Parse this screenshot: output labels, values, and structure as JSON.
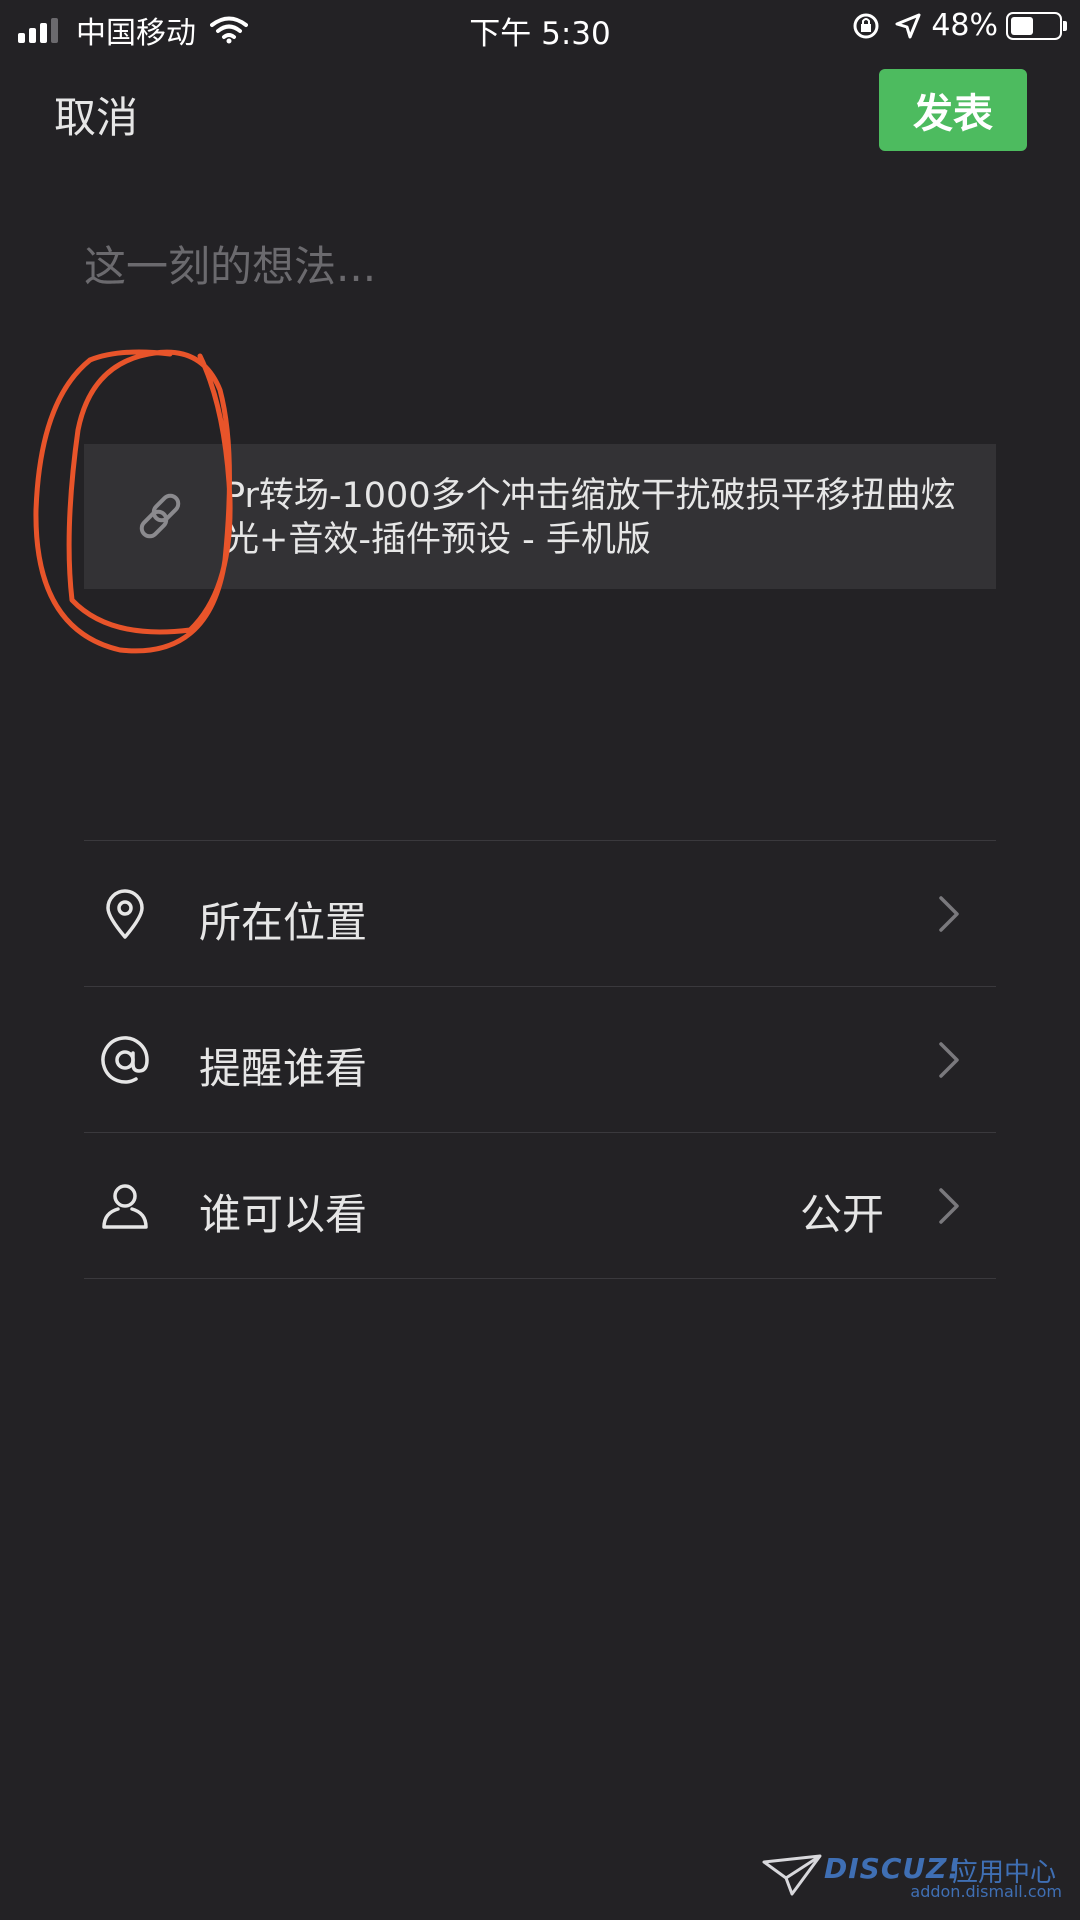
{
  "status_bar": {
    "carrier": "中国移动",
    "time": "下午 5:30",
    "battery_pct": "48%",
    "battery_level": 0.48,
    "signal_bars": 3
  },
  "header": {
    "cancel_label": "取消",
    "publish_label": "发表",
    "publish_color": "#4dbb5f"
  },
  "compose": {
    "placeholder": "这一刻的想法...",
    "value": ""
  },
  "link_card": {
    "icon": "link-icon",
    "title": "Pr转场-1000多个冲击缩放干扰破损平移扭曲炫光+音效-插件预设 - 手机版"
  },
  "options": {
    "location": {
      "icon": "location-pin-icon",
      "label": "所在位置"
    },
    "mention": {
      "icon": "at-icon",
      "label": "提醒谁看"
    },
    "visibility": {
      "icon": "person-icon",
      "label": "谁可以看",
      "value": "公开"
    }
  },
  "watermark": {
    "brand": "DISCUZ!",
    "center": "应用中心",
    "url": "addon.dismall.com",
    "color": "#3f6fb4"
  },
  "annotation": {
    "color": "#e8542a"
  }
}
